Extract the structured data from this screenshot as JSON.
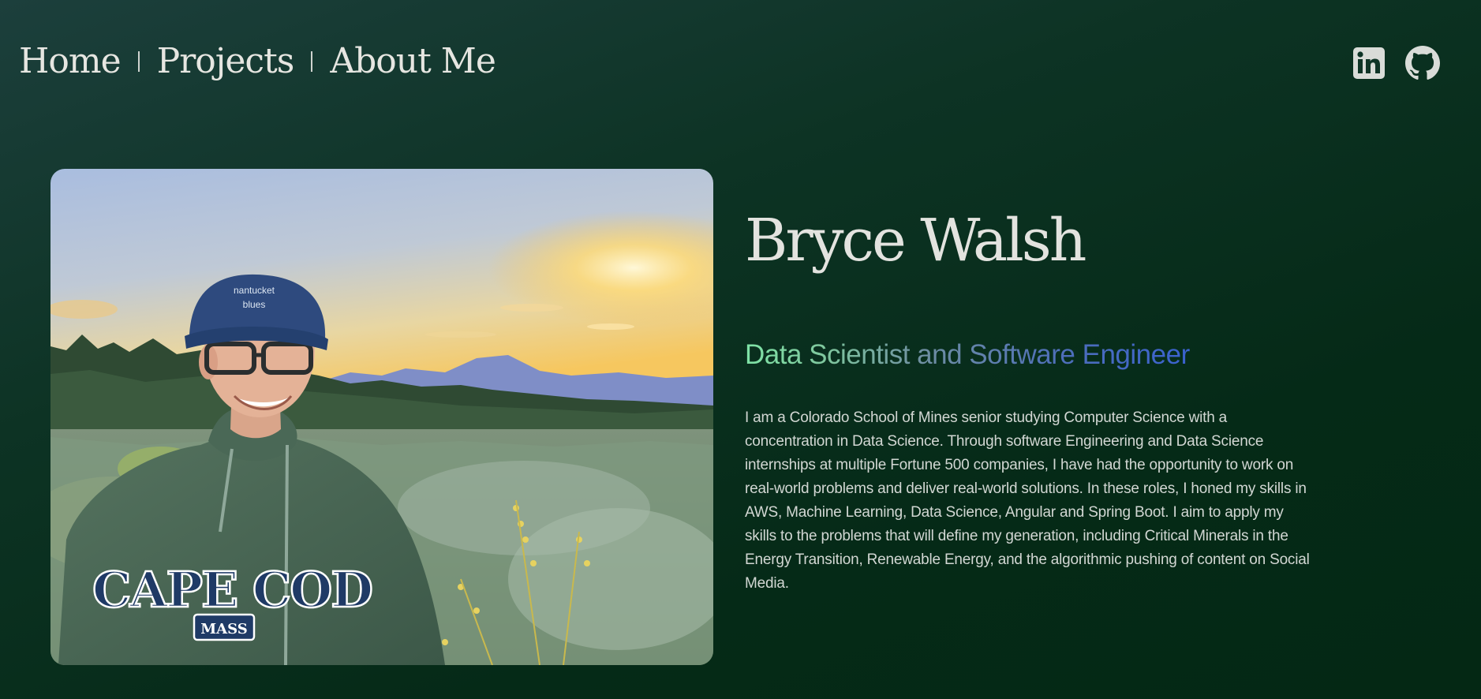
{
  "nav": {
    "items": [
      "Home",
      "Projects",
      "About Me"
    ]
  },
  "social": {
    "linkedin_icon": "linkedin-icon",
    "github_icon": "github-icon",
    "icon_color": "#d9dcd8"
  },
  "hero": {
    "name": "Bryce Walsh",
    "subtitle": "Data Scientist and Software Engineer",
    "bio": "I am a Colorado School of Mines senior studying Computer Science with a concentration in Data Science. Through software Engineering and Data Science internships at multiple Fortune 500 companies, I have had the opportunity to work on real-world problems and deliver real-world solutions. In these roles, I honed my skills in AWS, Machine Learning, Data Science, Angular and Spring Boot. I aim to apply my skills to the problems that will define my generation, including Critical Minerals in the Energy Transition, Renewable Energy, and the algorithmic pushing of content on Social Media.",
    "photo": {
      "hat_text_top": "nantucket",
      "hat_text_bottom": "blues",
      "hoodie_text": "CAPE COD",
      "hoodie_badge": "MASS"
    }
  },
  "colors": {
    "background": "#052a17",
    "text": "#e6e6e1",
    "subtitle_start": "#7fe3a6",
    "subtitle_end": "#3a62cf"
  }
}
